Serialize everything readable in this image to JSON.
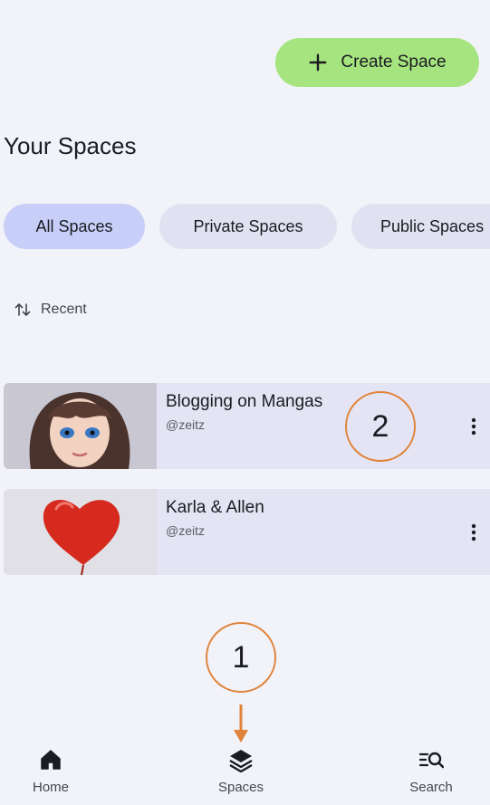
{
  "header": {
    "create_button_label": "Create Space"
  },
  "page": {
    "title": "Your Spaces"
  },
  "filters": {
    "chips": [
      "All Spaces",
      "Private Spaces",
      "Public Spaces"
    ],
    "active": "All Spaces"
  },
  "sort": {
    "label": "Recent"
  },
  "spaces": [
    {
      "title": "Blogging on Mangas",
      "handle": "@zeitz"
    },
    {
      "title": "Karla & Allen",
      "handle": "@zeitz"
    }
  ],
  "annotations": {
    "callout_1": "1",
    "callout_2": "2"
  },
  "bottom_nav": [
    {
      "label": "Home",
      "icon": "home-icon"
    },
    {
      "label": "Spaces",
      "icon": "layers-icon"
    },
    {
      "label": "Search",
      "icon": "search-list-icon"
    }
  ],
  "colors": {
    "accent_green": "#a6e47f",
    "chip_active": "#c7cff8",
    "callout_orange": "#e0843b"
  }
}
